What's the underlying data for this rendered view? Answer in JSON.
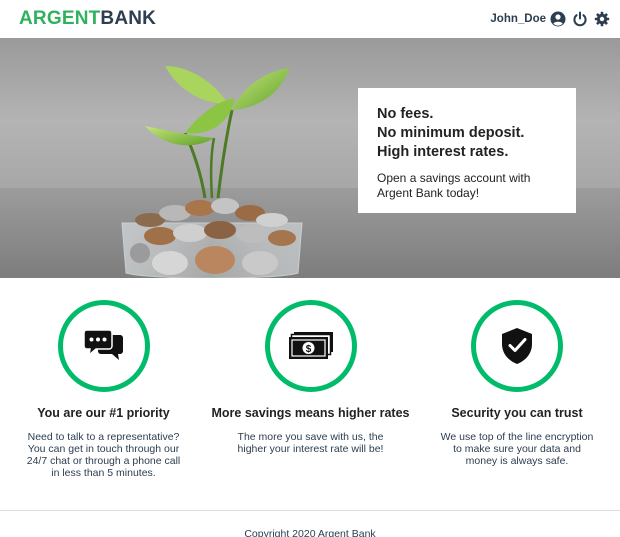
{
  "header": {
    "logo_part1": "ARGENT",
    "logo_part2": "BANK",
    "username": "John_Doe",
    "icons": [
      "user-circle-icon",
      "power-icon",
      "gear-icon"
    ]
  },
  "hero": {
    "headline": [
      "No fees.",
      "No minimum deposit.",
      "High interest rates."
    ],
    "text": "Open a savings account with Argent Bank today!"
  },
  "features": [
    {
      "icon": "chat-icon",
      "title": "You are our #1 priority",
      "text": "Need to talk to a representative? You can get in touch through our 24/7 chat or through a phone call in less than 5 minutes."
    },
    {
      "icon": "money-icon",
      "title": "More savings means higher rates",
      "text": "The more you save with us, the higher your interest rate will be!"
    },
    {
      "icon": "shield-icon",
      "title": "Security you can trust",
      "text": "We use top of the line encryption to make sure your data and money is always safe."
    }
  ],
  "footer": {
    "copyright": "Copyright 2020 Argent Bank"
  },
  "colors": {
    "brand_green": "#2fb15d",
    "circle_green": "#00bc6a",
    "text_dark": "#2c3e50"
  }
}
